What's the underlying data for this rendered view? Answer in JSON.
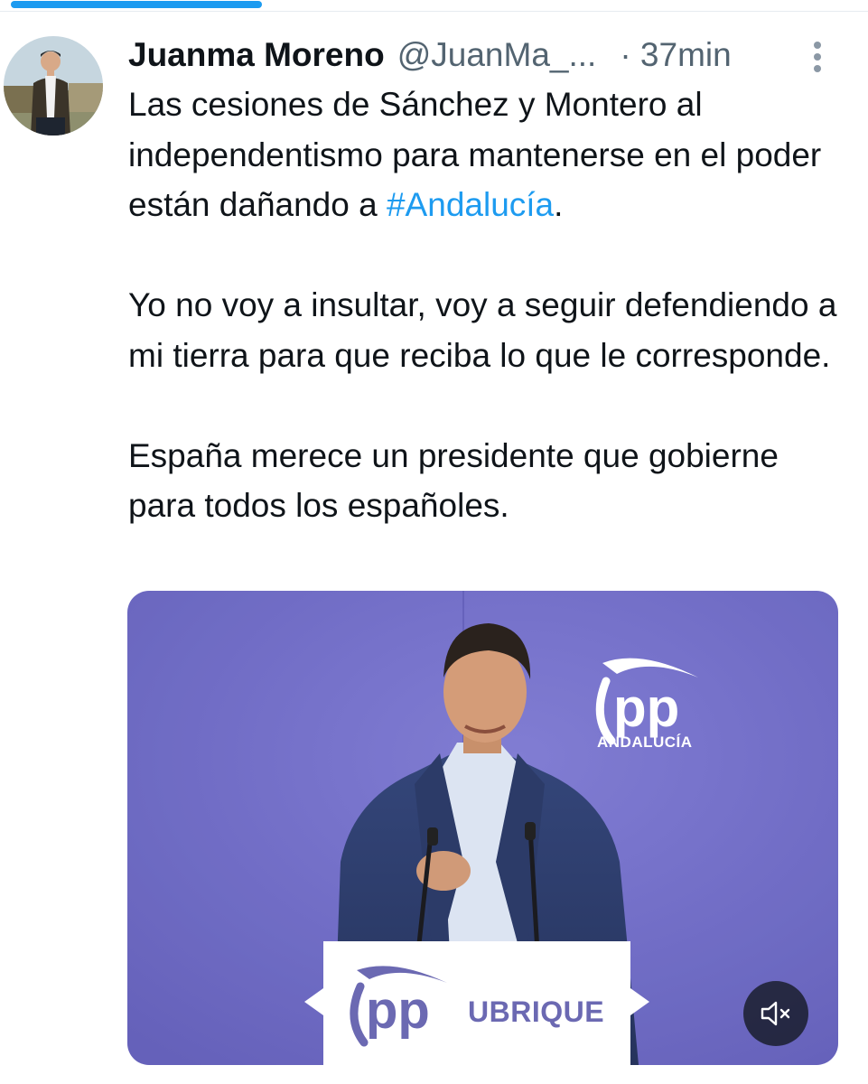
{
  "post": {
    "author_name": "Juanma Moreno",
    "author_handle": "@JuanMa_...",
    "time": "· 37min",
    "paragraph1_text": "Las cesiones de Sánchez y Montero al independentismo para mantenerse en el poder están dañando a ",
    "hashtag": "#Andalucía",
    "paragraph1_end": ".",
    "paragraph2": "Yo no voy a insultar, voy a seguir defendiendo a mi tierra para que reciba lo que le corresponde.",
    "paragraph3": "España merece un presidente que gobierne para todos los españoles."
  },
  "media": {
    "wall_logo_text": "pp",
    "wall_region_text": "ANDALUCÍA",
    "podium_logo_text": "pp",
    "podium_text": "UBRIQUE"
  },
  "icons": {
    "more": "more-vertical-icon",
    "mute": "speaker-muted-icon"
  },
  "colors": {
    "hashtag": "#1d9bf0",
    "secondary_text": "#536471",
    "video_background": "#6f6bc6",
    "pp_purple": "#6b69b2",
    "top_indicator": "#1d9bf0"
  }
}
